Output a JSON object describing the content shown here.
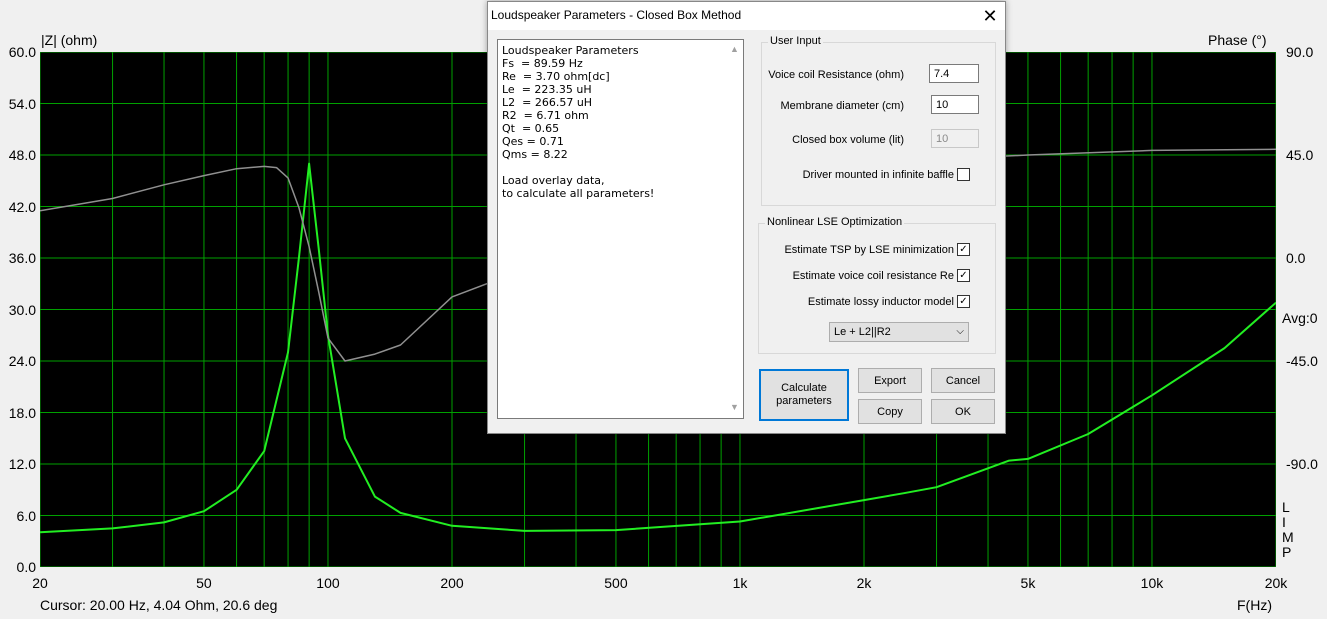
{
  "graph": {
    "left_axis_title": "|Z| (ohm)",
    "right_axis_title": "Phase (°)",
    "avg_label": "Avg:0",
    "left_ticks": [
      "60.0",
      "54.0",
      "48.0",
      "42.0",
      "36.0",
      "30.0",
      "24.0",
      "18.0",
      "12.0",
      "6.0",
      "0.0"
    ],
    "right_ticks": [
      "90.0",
      "45.0",
      "0.0",
      "-45.0",
      "-90.0"
    ],
    "x_ticks": [
      "20",
      "50",
      "100",
      "200",
      "500",
      "1k",
      "2k",
      "5k",
      "10k",
      "20k"
    ],
    "x_axis_title": "F(Hz)",
    "cursor_readout": "Cursor: 20.00 Hz, 4.04 Ohm, 20.6 deg",
    "limp_letters": [
      "L",
      "I",
      "M",
      "P"
    ],
    "colors": {
      "background": "#000000",
      "grid": "#00a000",
      "impedance": "#22ee22",
      "phase": "#909090"
    }
  },
  "chart_data": {
    "type": "line",
    "xscale": "log",
    "xlim": [
      20,
      20000
    ],
    "ylim": [
      0,
      60
    ],
    "y2lim": [
      -135,
      90
    ],
    "xlabel": "F(Hz)",
    "ylabel": "|Z| (ohm)",
    "y2label": "Phase (°)",
    "grid": true,
    "series": [
      {
        "axis": "left",
        "color": "#22ee22",
        "x": [
          20,
          30,
          40,
          50,
          60,
          70,
          80,
          85,
          90,
          95,
          100,
          110,
          130,
          150,
          200,
          300,
          500,
          1000,
          2000,
          2500,
          3000,
          4000,
          4500,
          5000,
          7000,
          10000,
          15000,
          20000
        ],
        "y": [
          4.04,
          4.5,
          5.2,
          6.5,
          9.0,
          13.5,
          25.0,
          36.0,
          47.0,
          37.0,
          27.0,
          15.0,
          8.2,
          6.3,
          4.8,
          4.2,
          4.3,
          5.3,
          7.8,
          8.6,
          9.3,
          11.5,
          12.4,
          12.6,
          15.5,
          20.0,
          25.5,
          30.8
        ]
      },
      {
        "axis": "right",
        "color": "#909090",
        "x": [
          20,
          30,
          40,
          50,
          60,
          70,
          75,
          80,
          85,
          90,
          95,
          100,
          110,
          130,
          150,
          200,
          300,
          500,
          1000,
          2000,
          3000,
          5000,
          10000,
          20000
        ],
        "y": [
          20.6,
          26.0,
          32.0,
          36.0,
          39.0,
          40.0,
          39.5,
          35.0,
          22.0,
          5.0,
          -15.0,
          -35.0,
          -45.0,
          -42.0,
          -38.0,
          -17.0,
          -5.0,
          8.0,
          25.0,
          38.0,
          43.0,
          45.0,
          47.0,
          47.5
        ]
      }
    ]
  },
  "dialog": {
    "title": "Loudspeaker Parameters - Closed Box Method",
    "results_lines": [
      "Loudspeaker Parameters",
      "Fs  = 89.59 Hz",
      "Re  = 3.70 ohm[dc]",
      "Le  = 223.35 uH",
      "L2  = 266.57 uH",
      "R2  = 6.71 ohm",
      "Qt  = 0.65",
      "Qes = 0.71",
      "Qms = 8.22",
      "",
      "Load overlay data,",
      "to calculate all parameters!"
    ],
    "user_input": {
      "group_title": "User Input",
      "voice_coil_label": "Voice coil Resistance (ohm)",
      "voice_coil_value": "7.4",
      "membrane_label": "Membrane diameter (cm)",
      "membrane_value": "10",
      "box_volume_label": "Closed box volume (lit)",
      "box_volume_value": "10",
      "infinite_baffle_label": "Driver mounted in infinite baffle"
    },
    "nonlinear": {
      "group_title": "Nonlinear LSE Optimization",
      "estimate_tsp_label": "Estimate TSP by LSE minimization",
      "estimate_re_label": "Estimate voice coil resistance Re",
      "estimate_lossy_label": "Estimate lossy inductor model",
      "model_selected": "Le + L2||R2"
    },
    "buttons": {
      "calculate": "Calculate parameters",
      "export": "Export",
      "cancel": "Cancel",
      "copy": "Copy",
      "ok": "OK"
    }
  }
}
